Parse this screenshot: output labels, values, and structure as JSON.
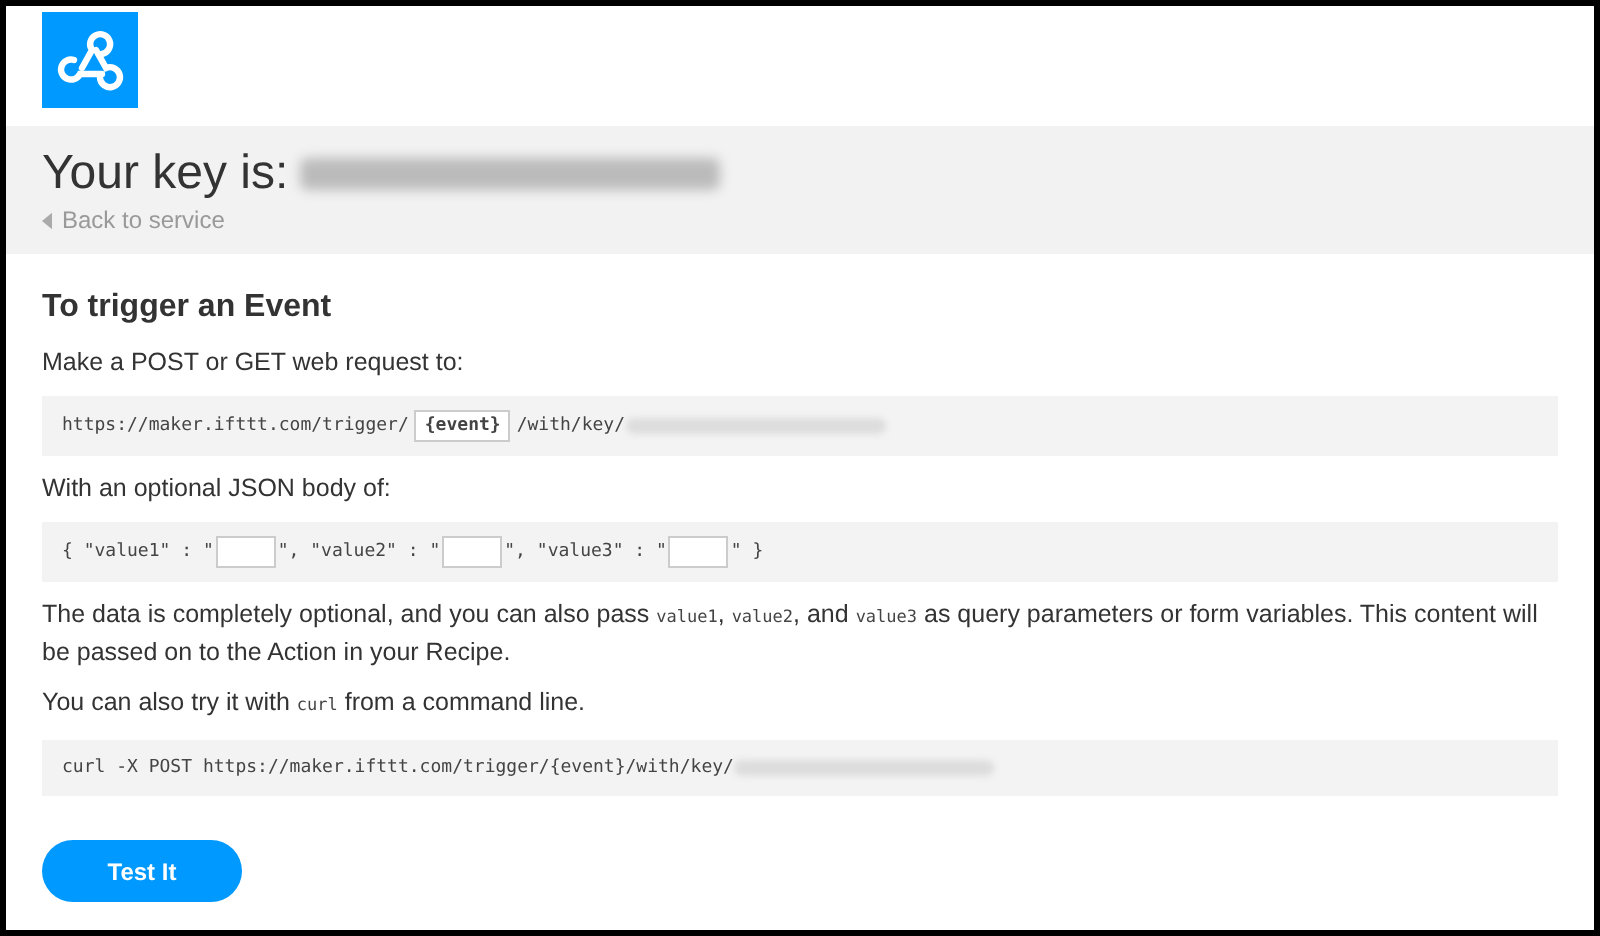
{
  "header": {
    "key_label": "Your key is:",
    "key_redacted": true,
    "back_link": "Back to service"
  },
  "section": {
    "title": "To trigger an Event",
    "request_intro": "Make a POST or GET web request to:",
    "request_url": [
      {
        "kind": "code",
        "text": "https://maker.ifttt.com/trigger/"
      },
      {
        "kind": "tag",
        "text": "{event}"
      },
      {
        "kind": "code",
        "text": "/with/key/"
      },
      {
        "kind": "redacted"
      }
    ],
    "body_intro": "With an optional JSON body of:",
    "body": [
      {
        "kind": "code",
        "text": "{ \"value1\" : \""
      },
      {
        "kind": "field"
      },
      {
        "kind": "code",
        "text": "\", \"value2\" : \""
      },
      {
        "kind": "field"
      },
      {
        "kind": "code",
        "text": "\", \"value3\" : \""
      },
      {
        "kind": "field"
      },
      {
        "kind": "code",
        "text": "\" }"
      }
    ],
    "note": [
      {
        "kind": "text",
        "text": "The data is completely optional, and you can also pass "
      },
      {
        "kind": "code",
        "text": "value1"
      },
      {
        "kind": "text",
        "text": ", "
      },
      {
        "kind": "code",
        "text": "value2"
      },
      {
        "kind": "text",
        "text": ", and "
      },
      {
        "kind": "code",
        "text": "value3"
      },
      {
        "kind": "text",
        "text": " as query parameters or form variables. This content will be passed on to the Action in your Recipe."
      }
    ],
    "curl_intro": [
      {
        "kind": "text",
        "text": "You can also try it with "
      },
      {
        "kind": "code",
        "text": "curl"
      },
      {
        "kind": "text",
        "text": " from a command line."
      }
    ],
    "curl_command": [
      {
        "kind": "code",
        "text": "curl -X POST https://maker.ifttt.com/trigger/{event}/with/key/"
      },
      {
        "kind": "redacted"
      }
    ],
    "button": "Test It"
  }
}
